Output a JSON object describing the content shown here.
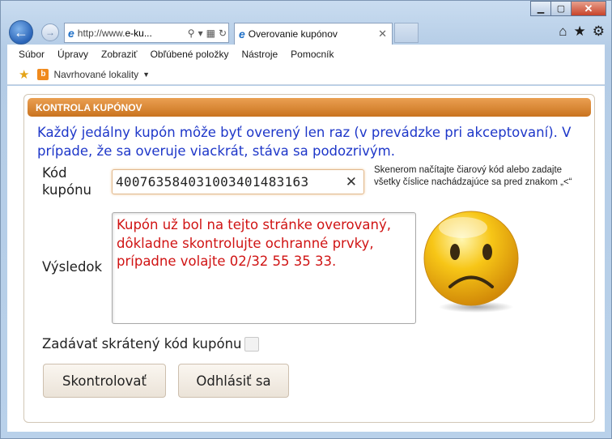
{
  "browser": {
    "address": "http://www.e-ku...",
    "address_prefix": "http://www.",
    "address_domain": "e-ku...",
    "tab_title": "Overovanie kupónov",
    "menu": [
      "Súbor",
      "Úpravy",
      "Zobraziť",
      "Obľúbené položky",
      "Nástroje",
      "Pomocník"
    ],
    "favorites_suggested": "Navrhované lokality"
  },
  "panel": {
    "header": "KONTROLA KUPÓNOV",
    "info": "Každý jedálny kupón môže byť overený len raz (v prevádzke pri akceptovaní). V prípade, že sa overuje viackrát, stáva sa podozrivým.",
    "code_label": "Kód kupónu",
    "code_value": "40076358403100340148316З",
    "hint": "Skenerom načítajte čiarový kód alebo zadajte všetky číslice nachádzajúce sa pred znakom „<“",
    "result_label": "Výsledok",
    "result_text": "Kupón už bol na tejto stránke overovaný, dôkladne skontrolujte ochranné prvky, prípadne volajte 02/32 55 35 33.",
    "short_code_label": "Zadávať skrátený kód kupónu",
    "check_button": "Skontrolovať",
    "logout_button": "Odhlásiť sa"
  },
  "icons": {
    "smiley": "sad-face-icon"
  },
  "colors": {
    "header_orange": "#d9852f",
    "info_blue": "#1e37c9",
    "result_red": "#d01414"
  }
}
